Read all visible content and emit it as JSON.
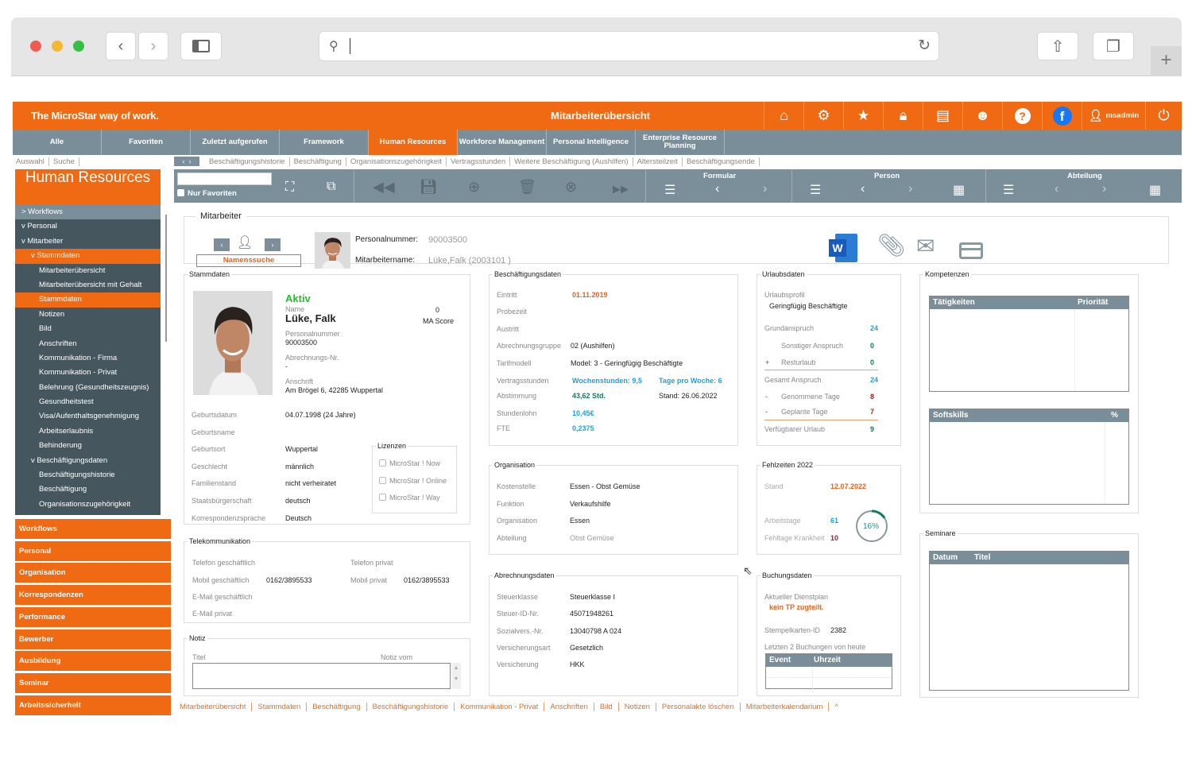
{
  "browser": {
    "icons": [
      "sidebar-icon",
      "search-icon",
      "reload-icon",
      "share-icon",
      "tabs-icon",
      "new-tab-icon"
    ]
  },
  "header": {
    "slogan": "The MicroStar way of work.",
    "title": "Mitarbeiterübersicht",
    "user": "msadmin",
    "icons": [
      "home-icon",
      "gear-icon",
      "star-icon",
      "lock-icon",
      "calendar-icon",
      "support-icon",
      "help-icon",
      "facebook-icon",
      "user-icon",
      "power-icon"
    ]
  },
  "nav": {
    "tabs": [
      "Alle",
      "Favoriten",
      "Zuletzt aufgerufen",
      "Framework",
      "Human Resources",
      "Workforce Management",
      "Personal Intelligence",
      "Enterprise Resource Planning"
    ],
    "active": "Human Resources"
  },
  "left_crumbs": [
    "Auswahl",
    "Suche"
  ],
  "crumbs": [
    "Beschäftigungshistorie",
    "Beschäftigung",
    "Organisationszugehörigkeit",
    "Vertragsstunden",
    "Weitere Beschäftigung (Aushilfen)",
    "Altersteilzeit",
    "Beschäftigungsende"
  ],
  "sidebar": {
    "title": "Human Resources",
    "tree": [
      {
        "label": "> Workflows",
        "lvl": 0
      },
      {
        "label": "v  Personal",
        "lvl": 0
      },
      {
        "label": "v  Mitarbeiter",
        "lvl": 1
      },
      {
        "label": "v  Stammdaten",
        "lvl": 2
      },
      {
        "label": "Mitarbeiterübersicht",
        "lvl": 3
      },
      {
        "label": "Mitarbeiterübersicht mit Gehalt",
        "lvl": 3
      },
      {
        "label": "Stammdaten",
        "lvl": 3
      },
      {
        "label": "Notizen",
        "lvl": 3
      },
      {
        "label": "Bild",
        "lvl": 3
      },
      {
        "label": "Anschriften",
        "lvl": 3
      },
      {
        "label": "Kommunikation - Firma",
        "lvl": 3
      },
      {
        "label": "Kommunikation - Privat",
        "lvl": 3
      },
      {
        "label": "Belehrung (Gesundheitszeugnis)",
        "lvl": 3
      },
      {
        "label": "Gesundheitstest",
        "lvl": 3
      },
      {
        "label": "Visa/Aufenthaltsgenehmigung",
        "lvl": 3
      },
      {
        "label": "Arbeitserlaubnis",
        "lvl": 3
      },
      {
        "label": "Behinderung",
        "lvl": 3
      },
      {
        "label": "v  Beschäftigungsdaten",
        "lvl": 2
      },
      {
        "label": "Beschäftigungshistorie",
        "lvl": 3
      },
      {
        "label": "Beschäftigung",
        "lvl": 3
      },
      {
        "label": "Organisationszugehörigkeit",
        "lvl": 3
      }
    ],
    "sections": [
      "Workflows",
      "Personal",
      "Organisation",
      "Korrespondenzen",
      "Performance",
      "Bewerber",
      "Ausbildung",
      "Seminar",
      "Arbeitssicherheit"
    ]
  },
  "toolbar": {
    "search_value": "",
    "favorites_label": "Nur Favoriten",
    "formular": "Formular",
    "person": "Person",
    "abteilung": "Abteilung"
  },
  "mitarbeiter": {
    "legend": "Mitarbeiter",
    "search_btn": "Namenssuche",
    "pn_label": "Personalnummer:",
    "pn": "90003500",
    "name_label": "Mitarbeitername:",
    "name": "Lüke,Falk (2003101 )"
  },
  "stammdaten": {
    "legend": "Stammdaten",
    "status": "Aktiv",
    "name_label": "Name",
    "name": "Lüke, Falk",
    "score": "0",
    "score_label": "MA Score",
    "pn_label": "Personalnummer",
    "pn": "90003500",
    "abr_label": "Abrechnungs-Nr.",
    "abr": "-",
    "addr_label": "Anschrift",
    "addr": "Am Brögel 6, 42285 Wuppertal",
    "rows": [
      [
        "Geburtsdatum",
        "04.07.1998 (24 Jahre)"
      ],
      [
        "Geburtsname",
        ""
      ],
      [
        "Geburtsort",
        "Wuppertal"
      ],
      [
        "Geschlecht",
        "männlich"
      ],
      [
        "Familienstand",
        "nicht verheiratet"
      ],
      [
        "Staatsbürgerschaft",
        "deutsch"
      ],
      [
        "Korrespondenzsprache",
        "Deutsch"
      ]
    ],
    "lizenzen": {
      "legend": "Lizenzen",
      "items": [
        "MicroStar ! Now",
        "MicroStar ! Online",
        "MicroStar ! Way"
      ]
    }
  },
  "beschaeftigung": {
    "legend": "Beschäftigungsdaten",
    "eintritt_label": "Eintritt",
    "eintritt": "01.11.2019",
    "probezeit_label": "Probezeit",
    "austritt_label": "Austritt",
    "abrgr_label": "Abrechnungsgruppe",
    "abrgr": "02 (Aushilfen)",
    "tarif_label": "Tarifmodell",
    "tarif": "Model: 3 - Geringfügig Beschäftigte",
    "vs_label": "Vertragsstunden",
    "wochenstunden": "Wochenstunden: 9,5",
    "tage": "Tage pro Woche: 6",
    "abst_label": "Abstimmung",
    "abst": "43,62 Std.",
    "stand": "Stand: 26.06.2022",
    "lohn_label": "Stundenlohn",
    "lohn": "10,45€",
    "fte_label": "FTE",
    "fte": "0,2375"
  },
  "urlaub": {
    "legend": "Urlaubsdaten",
    "profil_label": "Urlaubsprofil",
    "profil": "Geringfügig Beschäftigte",
    "grund_label": "Grundanspruch",
    "grund": "24",
    "sonst_label": "Sonstiger Anspruch",
    "sonst": "0",
    "rest_label": "Resturlaub",
    "rest": "0",
    "gesamt_label": "Gesamt Anspruch",
    "gesamt": "24",
    "genommen_label": "Genommene Tage",
    "genommen": "8",
    "geplant_label": "Geplante Tage",
    "geplant": "7",
    "verf_label": "Verfügbarer Urlaub",
    "verf": "9",
    "plus": "+",
    "minus": "-"
  },
  "kompetenzen": {
    "legend": "Kompetenzen",
    "t1": [
      "Tätigkeiten",
      "Priorität"
    ],
    "t2": [
      "Softskills",
      "%"
    ]
  },
  "organisation": {
    "legend": "Organisation",
    "rows": [
      [
        "Kostenstelle",
        "Essen - Obst  Gemüse"
      ],
      [
        "Funktion",
        "Verkaufshilfe"
      ],
      [
        "Organisation",
        "Essen"
      ],
      [
        "Abteilung",
        "Obst  Gemüse"
      ]
    ]
  },
  "fehlzeiten": {
    "legend": "Fehlzeiten 2022",
    "stand_label": "Stand",
    "stand": "12.07.2022",
    "at_label": "Arbeitstage",
    "at": "61",
    "fk_label": "Fehltage Krankheit",
    "fk": "10",
    "percent": "16%",
    "percent_value": 16
  },
  "telekom": {
    "legend": "Telekommunikation",
    "tg_label": "Telefon geschäftlich",
    "tp_label": "Telefon privat",
    "mg_label": "Mobil geschäftlich",
    "mg": "0162/3895533",
    "mp_label": "Mobil privat",
    "mp": "0162/3895533",
    "eg_label": "E-Mail geschäftlich",
    "ep_label": "E-Mail privat"
  },
  "notiz": {
    "legend": "Notiz",
    "titel": "Titel",
    "vom": "Notiz vom"
  },
  "abrechnung": {
    "legend": "Abrechnungsdaten",
    "rows": [
      [
        "Steuerklasse",
        "Steuerklasse I"
      ],
      [
        "Steuer-ID-Nr.",
        "45071948261"
      ],
      [
        "Sozialvers.-Nr.",
        "13040798 A 024"
      ],
      [
        "Versicherungsart",
        "Gesetzlich"
      ],
      [
        "Versicherung",
        "HKK"
      ]
    ]
  },
  "buchung": {
    "legend": "Buchungsdaten",
    "dp_label": "Aktueller Dienstplan",
    "dp": "kein TP zugteilt.",
    "sk_label": "Stempelkarten-ID",
    "sk": "2382",
    "letzte": "Letzten 2 Buchungen von heute",
    "cols": [
      "Event",
      "Uhrzeit"
    ]
  },
  "seminare": {
    "legend": "Seminare",
    "cols": [
      "Datum",
      "Titel"
    ]
  },
  "footer": {
    "links": [
      "Mitarbeiterübersicht",
      "Stammdaten",
      "Beschäftigung",
      "Beschäftigungshistorie",
      "Kommunikation - Privat",
      "Anschriften",
      "Bild",
      "Notizen",
      "Personalakte löschen",
      "Mitarbeiterkalendarium",
      "^"
    ]
  },
  "colors": {
    "orange": "#f06a14",
    "navgrey": "#7a8e99",
    "sidebar": "#46565f",
    "green": "#22c02a",
    "blue": "#1ea0e0",
    "teal": "#137a5a",
    "red": "#a3222a"
  }
}
